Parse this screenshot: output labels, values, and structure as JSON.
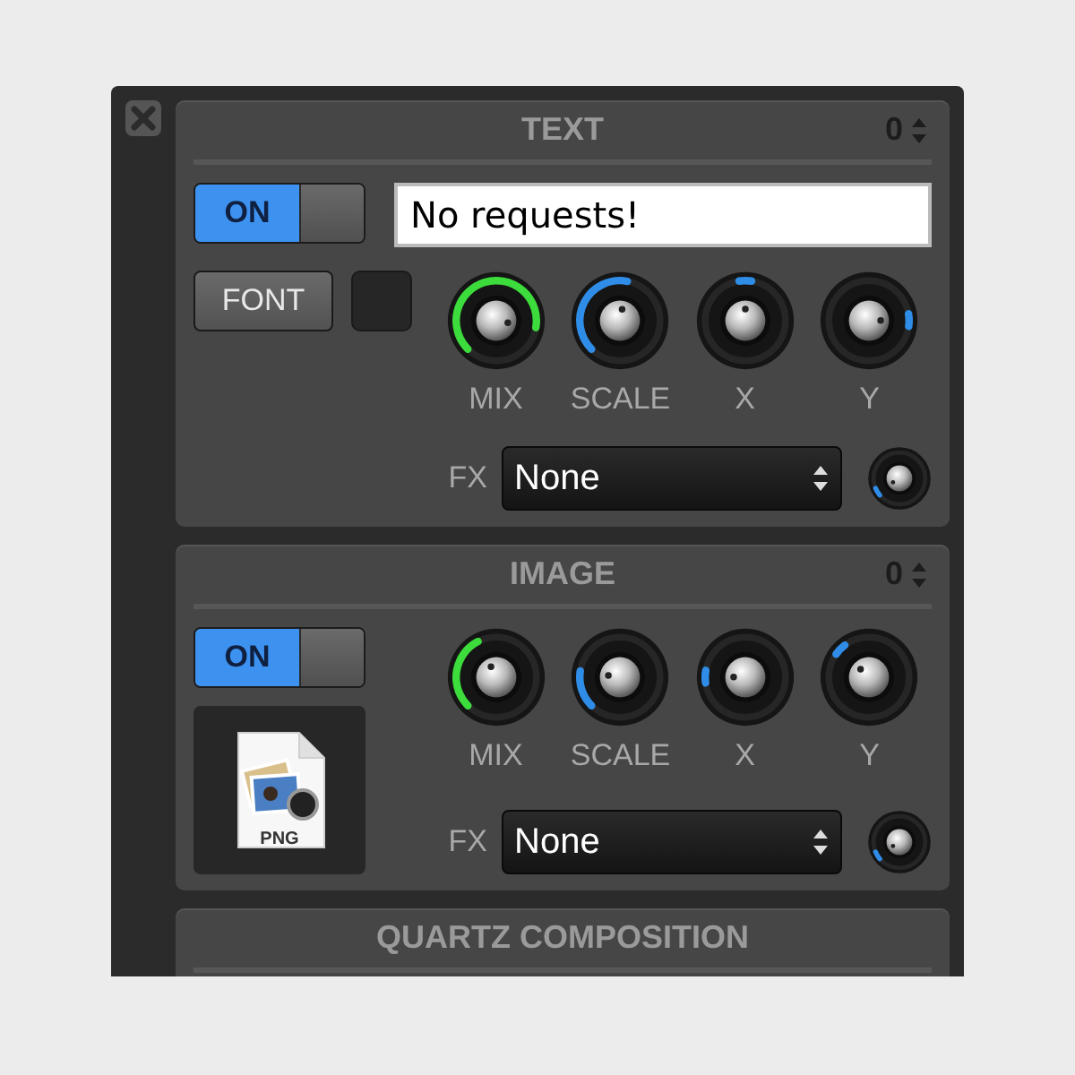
{
  "panels": [
    {
      "kind": "text",
      "title": "TEXT",
      "layer": "0",
      "enabled": true,
      "toggle_label": "ON",
      "text_value": "No requests!",
      "font_button": "FONT",
      "knobs": [
        {
          "label": "MIX",
          "kind": "arc",
          "color": "#3ddc3d"
        },
        {
          "label": "SCALE",
          "kind": "arc",
          "color": "#2f8de8"
        },
        {
          "label": "X",
          "kind": "point",
          "color": "#2f8de8"
        },
        {
          "label": "Y",
          "kind": "point",
          "color": "#2f8de8"
        }
      ],
      "fx_label": "FX",
      "fx_value": "None"
    },
    {
      "kind": "image",
      "title": "IMAGE",
      "layer": "0",
      "enabled": true,
      "toggle_label": "ON",
      "file_type": "PNG",
      "knobs": [
        {
          "label": "MIX",
          "kind": "arc",
          "color": "#3ddc3d"
        },
        {
          "label": "SCALE",
          "kind": "arc",
          "color": "#2f8de8"
        },
        {
          "label": "X",
          "kind": "point",
          "color": "#2f8de8"
        },
        {
          "label": "Y",
          "kind": "point",
          "color": "#2f8de8"
        }
      ],
      "fx_label": "FX",
      "fx_value": "None"
    },
    {
      "kind": "composition",
      "title": "QUARTZ COMPOSITION"
    }
  ]
}
